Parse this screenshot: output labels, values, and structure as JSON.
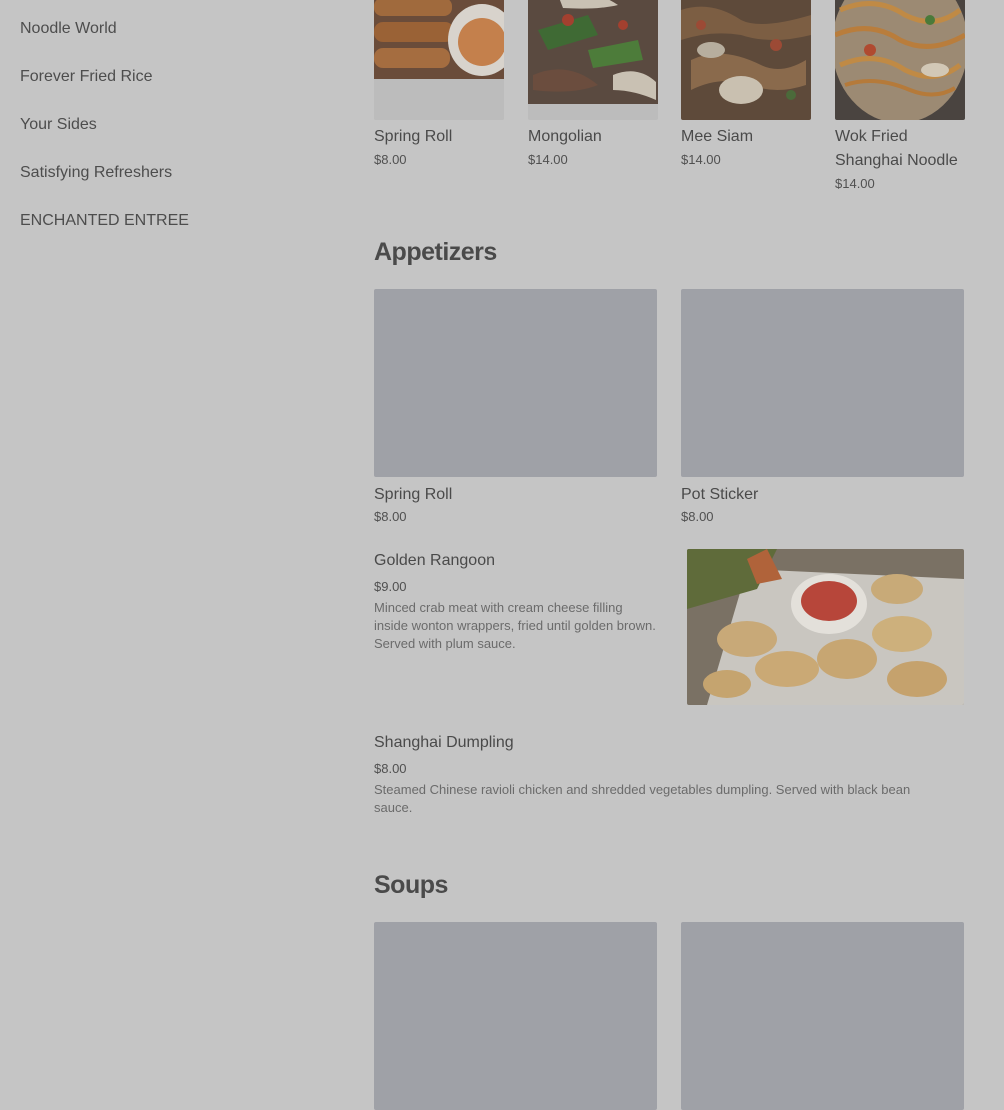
{
  "sidebar": {
    "items": [
      {
        "label": "Noodle World"
      },
      {
        "label": "Forever Fried Rice"
      },
      {
        "label": "Your Sides"
      },
      {
        "label": "Satisfying Refreshers"
      },
      {
        "label": "ENCHANTED ENTREE"
      }
    ]
  },
  "featured": [
    {
      "name": "Spring Roll",
      "price": "$8.00"
    },
    {
      "name": "Mongolian",
      "price": "$14.00"
    },
    {
      "name": "Mee Siam",
      "price": "$14.00"
    },
    {
      "name": "Wok Fried Shanghai Noodle",
      "price": "$14.00"
    }
  ],
  "appetizers": {
    "title": "Appetizers",
    "cards": [
      {
        "name": "Spring Roll",
        "price": "$8.00"
      },
      {
        "name": "Pot Sticker",
        "price": "$8.00"
      }
    ],
    "golden_rangoon": {
      "name": "Golden Rangoon",
      "price": "$9.00",
      "description": "Minced crab meat with cream cheese filling inside wonton wrappers, fried until golden brown. Served with plum sauce."
    },
    "shanghai_dumpling": {
      "name": "Shanghai Dumpling",
      "price": "$8.00",
      "description": "Steamed Chinese ravioli chicken and shredded vegetables dumpling. Served with black bean sauce."
    }
  },
  "soups": {
    "title": "Soups"
  },
  "colors": {
    "overlay_bg": "#c5c5c5",
    "placeholder": "#9fa1a7"
  }
}
